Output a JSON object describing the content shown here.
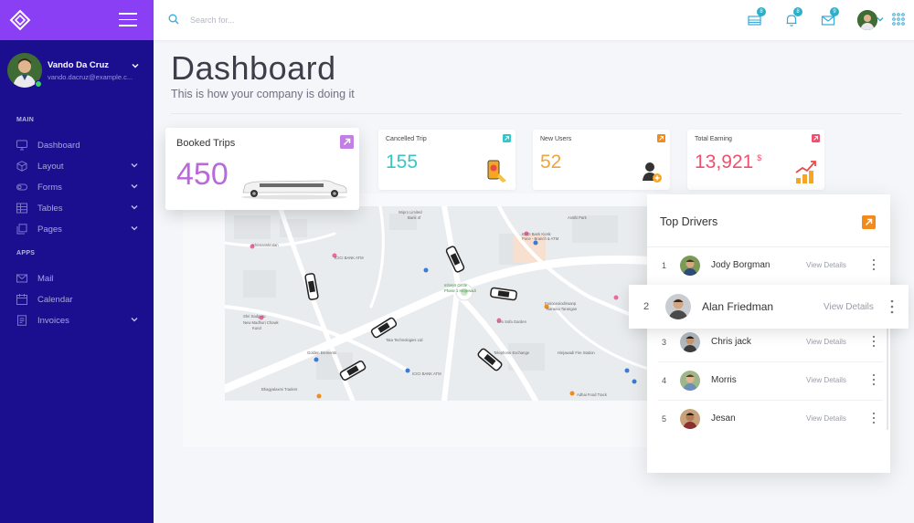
{
  "sidebar": {
    "profile": {
      "name": "Vando Da Cruz",
      "email": "vando.dacruz@example.c..."
    },
    "sections": [
      "MAIN",
      "APPS"
    ],
    "items": [
      {
        "label": "Dashboard",
        "icon": "monitor-icon",
        "has_caret": false
      },
      {
        "label": "Layout",
        "icon": "cube-icon",
        "has_caret": true
      },
      {
        "label": "Forms",
        "icon": "toggle-icon",
        "has_caret": true
      },
      {
        "label": "Tables",
        "icon": "table-icon",
        "has_caret": true
      },
      {
        "label": "Pages",
        "icon": "copy-icon",
        "has_caret": true
      },
      {
        "label": "Mail",
        "icon": "mail-icon",
        "has_caret": false
      },
      {
        "label": "Calendar",
        "icon": "calendar-icon",
        "has_caret": false
      },
      {
        "label": "Invoices",
        "icon": "invoice-icon",
        "has_caret": true
      }
    ]
  },
  "topbar": {
    "search_placeholder": "Search for...",
    "badges": {
      "messages": "8",
      "notifications": "8",
      "mail": "9"
    }
  },
  "page": {
    "title": "Dashboard",
    "subtitle": "This is how your company is doing it"
  },
  "stats": {
    "booked": {
      "title": "Booked Trips",
      "value": "450",
      "color": "#b96ad9"
    },
    "cancelled": {
      "title": "Cancelled Trip",
      "value": "155",
      "color": "#36c6c6"
    },
    "users": {
      "title": "New Users",
      "value": "52",
      "color": "#f1a33c"
    },
    "earning": {
      "title": "Total Earning",
      "value": "13,921",
      "unit": "$",
      "color": "#f0506e"
    }
  },
  "drivers": {
    "title": "Top Drivers",
    "view_label": "View Details",
    "list": [
      {
        "rank": "1",
        "name": "Jody Borgman"
      },
      {
        "rank": "2",
        "name": "Alan Friedman"
      },
      {
        "rank": "3",
        "name": "Chris jack"
      },
      {
        "rank": "4",
        "name": "Morris"
      },
      {
        "rank": "5",
        "name": "Jesan"
      }
    ]
  },
  "map": {
    "labels": [
      "Wipro Limited",
      "Bank of",
      "ICICI Bank Kiosk",
      "Pune - Branch & ATM",
      "Shivsanskrutan",
      "Arathi Park",
      "Ajit Ventures",
      "Shri Sadguru",
      "Kund",
      "Fairoceoiodirwanp",
      "New Madhuri Chowk",
      "Tata Technologies Ltd",
      "Infosys Circle",
      "Phase 1 Hinjewadi",
      "Telephone Exchange",
      "Hinjawadi Fire Station",
      "ICICI BANK ATM",
      "Golden Elements",
      "Naraina Tarangan",
      "Adhai Food Track",
      "Bhagyalaxmi Traders",
      "Leo Sofa Garden",
      "ICICI BANK ATM"
    ]
  }
}
